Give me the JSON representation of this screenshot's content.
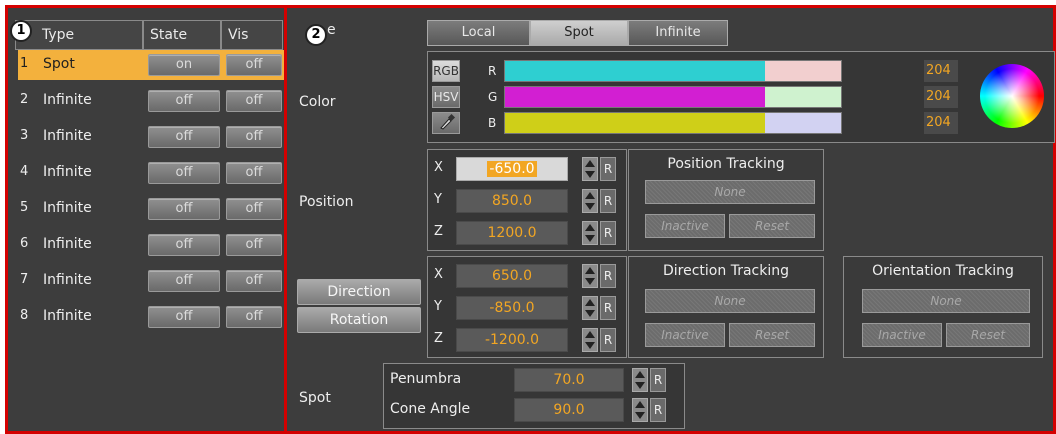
{
  "left_panel": {
    "badge": "1",
    "columns": {
      "type": "Type",
      "state": "State",
      "vis": "Vis"
    },
    "rows": [
      {
        "num": "1",
        "type": "Spot",
        "state": "on",
        "vis": "off"
      },
      {
        "num": "2",
        "type": "Infinite",
        "state": "off",
        "vis": "off"
      },
      {
        "num": "3",
        "type": "Infinite",
        "state": "off",
        "vis": "off"
      },
      {
        "num": "4",
        "type": "Infinite",
        "state": "off",
        "vis": "off"
      },
      {
        "num": "5",
        "type": "Infinite",
        "state": "off",
        "vis": "off"
      },
      {
        "num": "6",
        "type": "Infinite",
        "state": "off",
        "vis": "off"
      },
      {
        "num": "7",
        "type": "Infinite",
        "state": "off",
        "vis": "off"
      },
      {
        "num": "8",
        "type": "Infinite",
        "state": "off",
        "vis": "off"
      }
    ],
    "selected_row": 0
  },
  "right_panel": {
    "badge": "2",
    "type_label_visible": "e",
    "type_tabs": [
      "Local",
      "Spot",
      "Infinite"
    ],
    "selected_tab": "Spot",
    "color": {
      "label": "Color",
      "modes": [
        "RGB",
        "HSV"
      ],
      "selected_mode": "RGB",
      "picker_icon": "eyedropper-icon",
      "wheel_icon": "color-wheel-icon",
      "channels": [
        {
          "name": "R",
          "value": "204",
          "bar_color": "#2ecfd1",
          "light_color": "#f2cfcf"
        },
        {
          "name": "G",
          "value": "204",
          "bar_color": "#d21fd2",
          "light_color": "#cff2cf"
        },
        {
          "name": "B",
          "value": "204",
          "bar_color": "#cfcf18",
          "light_color": "#d2d2f2"
        }
      ]
    },
    "position": {
      "label": "Position",
      "fields": [
        {
          "axis": "X",
          "value": "-650.0",
          "reset": "R"
        },
        {
          "axis": "Y",
          "value": "850.0",
          "reset": "R"
        },
        {
          "axis": "Z",
          "value": "1200.0",
          "reset": "R"
        }
      ],
      "tracking": {
        "title": "Position Tracking",
        "target": "None",
        "inactive": "Inactive",
        "reset": "Reset"
      }
    },
    "direction": {
      "buttons": [
        "Direction",
        "Rotation"
      ],
      "fields": [
        {
          "axis": "X",
          "value": "650.0",
          "reset": "R"
        },
        {
          "axis": "Y",
          "value": "-850.0",
          "reset": "R"
        },
        {
          "axis": "Z",
          "value": "-1200.0",
          "reset": "R"
        }
      ],
      "direction_tracking": {
        "title": "Direction Tracking",
        "target": "None",
        "inactive": "Inactive",
        "reset": "Reset"
      },
      "orientation_tracking": {
        "title": "Orientation Tracking",
        "target": "None",
        "inactive": "Inactive",
        "reset": "Reset"
      }
    },
    "spot": {
      "label": "Spot",
      "fields": [
        {
          "name": "Penumbra",
          "value": "70.0",
          "reset": "R"
        },
        {
          "name": "Cone Angle",
          "value": "90.0",
          "reset": "R"
        }
      ]
    }
  },
  "colors": {
    "accent": "#f2a623",
    "highlight_border": "#d40000",
    "panel_bg": "#3d3d3d"
  }
}
